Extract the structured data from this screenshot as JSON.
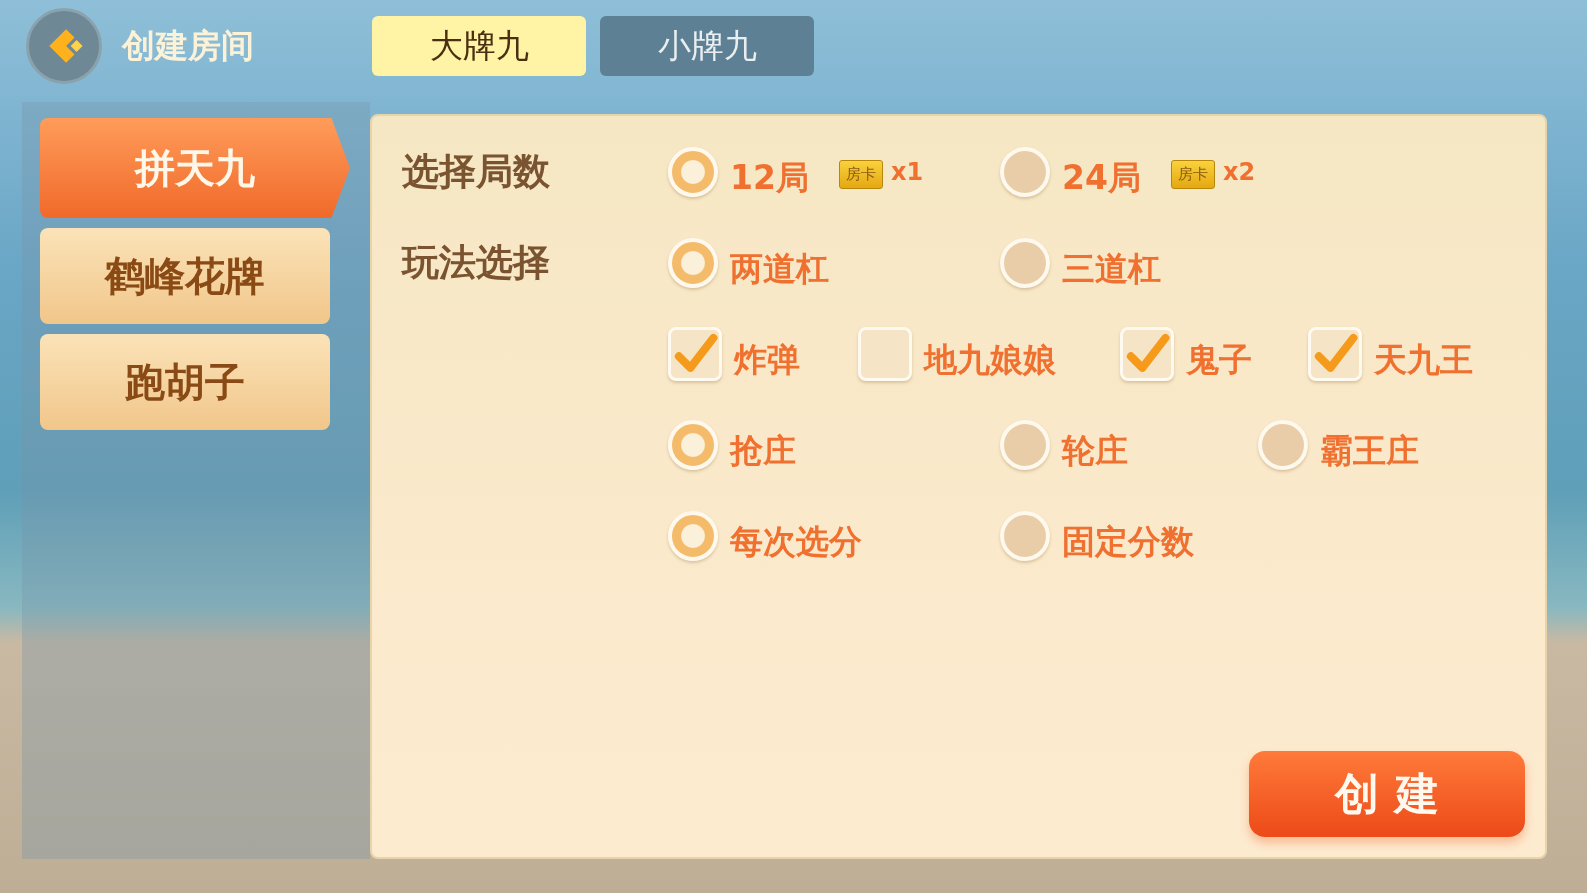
{
  "header": {
    "title": "创建房间"
  },
  "tabs": [
    {
      "label": "大牌九",
      "selected": true
    },
    {
      "label": "小牌九",
      "selected": false
    }
  ],
  "sidebar": {
    "items": [
      {
        "label": "拼天九",
        "selected": true
      },
      {
        "label": "鹤峰花牌",
        "selected": false
      },
      {
        "label": "跑胡子",
        "selected": false
      }
    ]
  },
  "settings": [
    {
      "label": "选择局数",
      "kind": "radio",
      "options": [
        {
          "label": "12局",
          "selected": true,
          "card": "房卡",
          "multiplier": "x1"
        },
        {
          "label": "24局",
          "selected": false,
          "card": "房卡",
          "multiplier": "x2"
        }
      ]
    },
    {
      "label": "玩法选择",
      "kind": "radio",
      "options": [
        {
          "label": "两道杠",
          "selected": true
        },
        {
          "label": "三道杠",
          "selected": false
        }
      ]
    },
    {
      "kind": "checkbox",
      "options": [
        {
          "label": "炸弹",
          "checked": true
        },
        {
          "label": "地九娘娘",
          "checked": false
        },
        {
          "label": "鬼子",
          "checked": true
        },
        {
          "label": "天九王",
          "checked": true
        }
      ]
    },
    {
      "kind": "radio",
      "options": [
        {
          "label": "抢庄",
          "selected": true
        },
        {
          "label": "轮庄",
          "selected": false
        },
        {
          "label": "霸王庄",
          "selected": false
        }
      ]
    },
    {
      "kind": "radio",
      "options": [
        {
          "label": "每次选分",
          "selected": true
        },
        {
          "label": "固定分数",
          "selected": false
        }
      ]
    }
  ],
  "create_button": "创 建"
}
